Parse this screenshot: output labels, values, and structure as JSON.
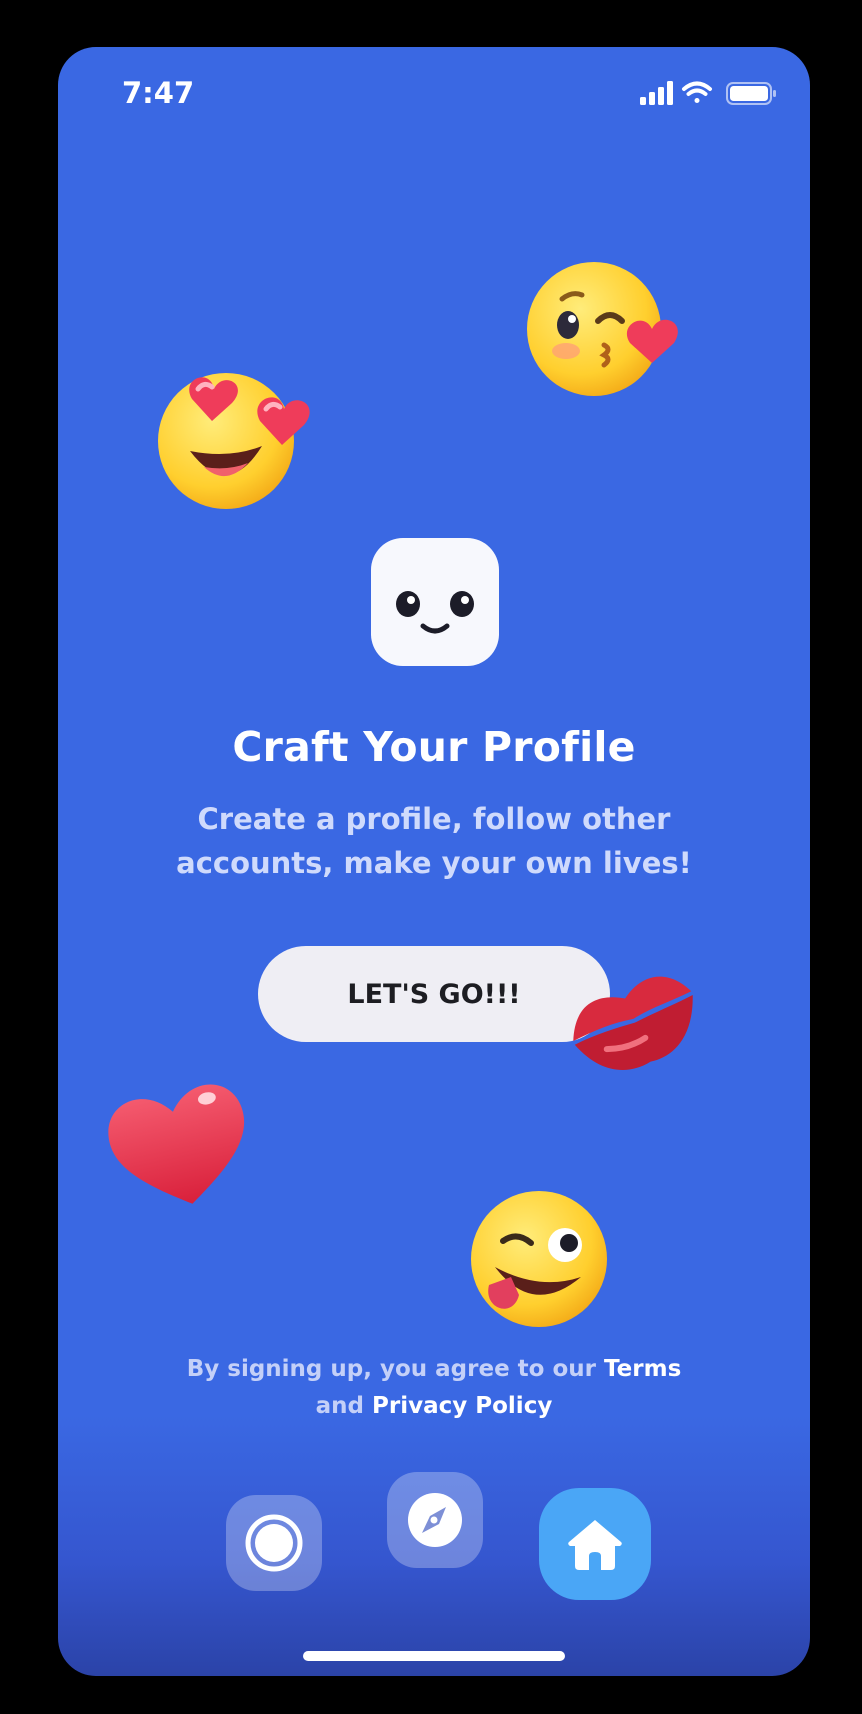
{
  "status_bar": {
    "time": "7:47"
  },
  "onboarding": {
    "title": "Craft Your Profile",
    "subtitle": "Create a profile, follow other accounts, make your own lives!",
    "cta_label": "LET'S GO!!!"
  },
  "legal": {
    "prefix": "By signing up, you agree to our",
    "terms_link": "Terms",
    "connector": "and",
    "privacy_link": "Privacy Policy"
  },
  "decorations": [
    "heart-eyes-emoji-icon",
    "kissing-heart-emoji-icon",
    "kiss-lips-icon",
    "red-heart-icon",
    "winking-tongue-emoji-icon",
    "mascot-icon"
  ],
  "bottom_nav": {
    "items": [
      "record-icon",
      "compass-icon",
      "home-icon"
    ],
    "active": "home"
  },
  "colors": {
    "background": "#3a68e3",
    "cta_background": "#efeef4",
    "home_button": "#4aa6f6",
    "subtitle_text": "#cfdafc"
  }
}
